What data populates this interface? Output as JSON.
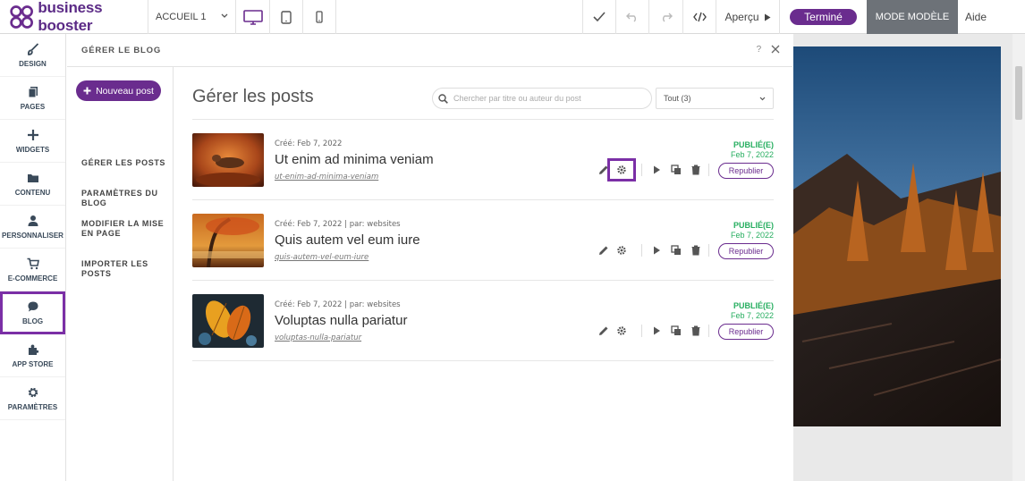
{
  "topbar": {
    "logo_text": "business booster",
    "page_select": "ACCUEIL 1",
    "preview_label": "Aperçu",
    "done_label": "Terminé",
    "mode_label": "MODE MODÈLE",
    "help_label": "Aide"
  },
  "sidebar": {
    "items": [
      {
        "label": "DESIGN",
        "icon": "brush-icon"
      },
      {
        "label": "PAGES",
        "icon": "pages-icon"
      },
      {
        "label": "WIDGETS",
        "icon": "plus-icon"
      },
      {
        "label": "CONTENU",
        "icon": "folder-icon"
      },
      {
        "label": "PERSONNALISER",
        "icon": "user-icon"
      },
      {
        "label": "E-COMMERCE",
        "icon": "cart-icon"
      },
      {
        "label": "BLOG",
        "icon": "chat-icon"
      },
      {
        "label": "APP STORE",
        "icon": "puzzle-icon"
      },
      {
        "label": "PARAMÈTRES",
        "icon": "gear-icon"
      }
    ]
  },
  "panel": {
    "header": "GÉRER LE BLOG",
    "help": "?",
    "new_post": "Nouveau post",
    "subnav": [
      "GÉRER LES POSTS",
      "PARAMÈTRES DU BLOG",
      "MODIFIER LA MISE EN PAGE",
      "IMPORTER LES POSTS"
    ],
    "title": "Gérer les posts",
    "search_placeholder": "Chercher par titre ou auteur du post",
    "filter": "Tout (3)",
    "republish_label": "Republier",
    "posts": [
      {
        "meta": "Créé: Feb 7, 2022",
        "title": "Ut enim ad minima veniam",
        "slug": "ut-enim-ad-minima-veniam",
        "status": "PUBLIÉ(E)",
        "date": "Feb 7, 2022"
      },
      {
        "meta": "Créé: Feb 7, 2022 | par: websites",
        "title": "Quis autem vel eum iure",
        "slug": "quis-autem-vel-eum-iure",
        "status": "PUBLIÉ(E)",
        "date": "Feb 7, 2022"
      },
      {
        "meta": "Créé: Feb 7, 2022 | par: websites",
        "title": "Voluptas nulla pariatur",
        "slug": "voluptas-nulla-pariatur",
        "status": "PUBLIÉ(E)",
        "date": "Feb 7, 2022"
      }
    ]
  },
  "colors": {
    "brand": "#6a2c8e",
    "published": "#27ae60",
    "highlight": "#7b2fa6"
  }
}
